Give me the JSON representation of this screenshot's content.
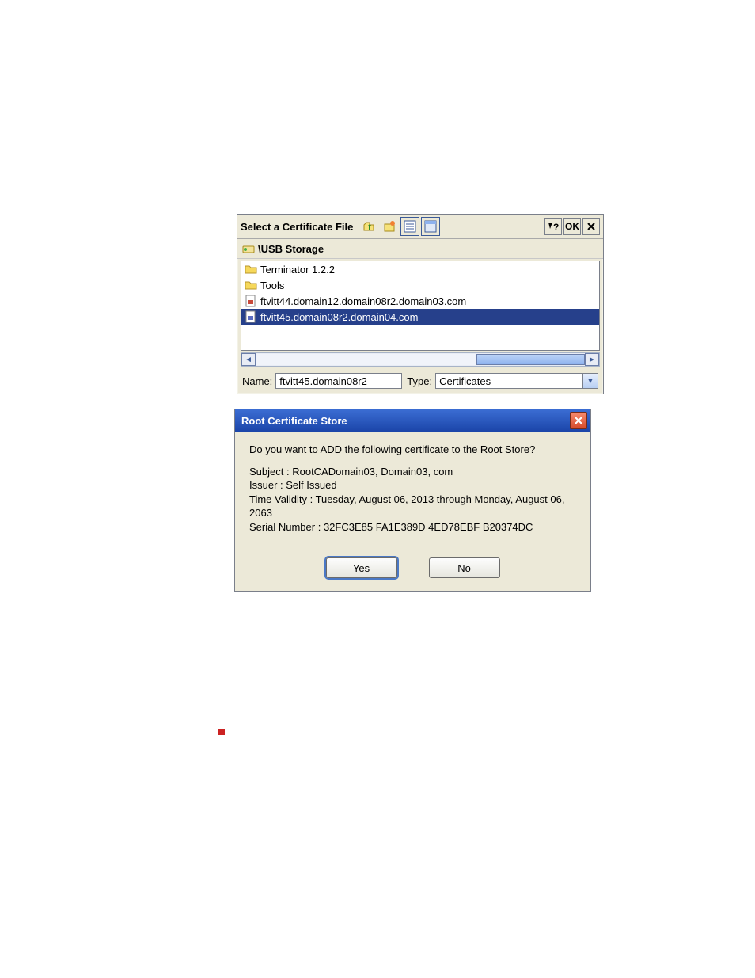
{
  "file_dialog": {
    "title": "Select a Certificate File",
    "ok_label": "OK",
    "help_label": "?",
    "path_label": "\\USB Storage",
    "items": [
      {
        "name": "Terminator 1.2.2",
        "type": "folder"
      },
      {
        "name": "Tools",
        "type": "folder"
      },
      {
        "name": "ftvitt44.domain12.domain08r2.domain03.com",
        "type": "file"
      },
      {
        "name": "ftvitt45.domain08r2.domain04.com",
        "type": "file",
        "selected": true
      }
    ],
    "name_label": "Name:",
    "name_value": "ftvitt45.domain08r2",
    "type_label": "Type:",
    "type_value": "Certificates"
  },
  "confirm": {
    "title": "Root Certificate Store",
    "question": "Do you want to ADD the following certificate to the Root Store?",
    "subject_label": "Subject :",
    "subject_value": "RootCADomain03, Domain03, com",
    "issuer_label": "Issuer :",
    "issuer_value": "Self Issued",
    "validity_label": "Time Validity :",
    "validity_value": "Tuesday, August 06, 2013 through Monday, August 06, 2063",
    "serial_label": "Serial Number :",
    "serial_value": "32FC3E85 FA1E389D 4ED78EBF B20374DC",
    "yes_label": "Yes",
    "no_label": "No"
  }
}
